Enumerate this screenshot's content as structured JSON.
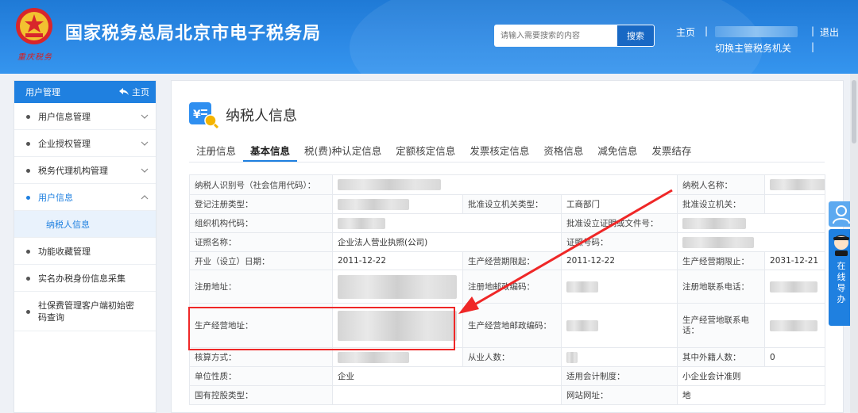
{
  "header": {
    "emblem_caption": "重庆税务",
    "site_title": "国家税务总局北京市电子税务局",
    "search_placeholder": "请输入需要搜索的内容",
    "search_button": "搜索",
    "home_link": "主页",
    "switch_link": "切换主管税务机关",
    "logout_link": "退出",
    "separator": "|"
  },
  "sidebar": {
    "header_title": "用户管理",
    "home_label": "主页",
    "items": [
      {
        "label": "用户信息管理"
      },
      {
        "label": "企业授权管理"
      },
      {
        "label": "税务代理机构管理"
      },
      {
        "label": "用户信息"
      },
      {
        "label": "纳税人信息"
      },
      {
        "label": "功能收藏管理"
      },
      {
        "label": "实名办税身份信息采集"
      },
      {
        "label": "社保费管理客户端初始密码查询"
      }
    ]
  },
  "main": {
    "page_title": "纳税人信息",
    "tabs": [
      {
        "label": "注册信息"
      },
      {
        "label": "基本信息"
      },
      {
        "label": "税(费)种认定信息"
      },
      {
        "label": "定额核定信息"
      },
      {
        "label": "发票核定信息"
      },
      {
        "label": "资格信息"
      },
      {
        "label": "减免信息"
      },
      {
        "label": "发票结存"
      }
    ],
    "fields": {
      "taxpayer_id_label": "纳税人识别号（社会信用代码）：",
      "taxpayer_name_label": "纳税人名称：",
      "reg_type_label": "登记注册类型：",
      "approve_type_label": "批准设立机关类型：",
      "approve_type_value": "工商部门",
      "approve_org_label": "批准设立机关：",
      "org_code_label": "组织机构代码：",
      "approve_doc_label": "批准设立证明或文件号：",
      "cert_name_label": "证照名称：",
      "cert_name_value": "企业法人营业执照(公司)",
      "cert_no_label": "证照号码：",
      "open_date_label": "开业（设立）日期：",
      "open_date_value": "2011-12-22",
      "period_start_label": "生产经营期限起：",
      "period_start_value": "2011-12-22",
      "period_end_label": "生产经营期限止：",
      "period_end_value": "2031-12-21",
      "reg_addr_label": "注册地址：",
      "reg_post_label": "注册地邮政编码：",
      "reg_phone_label": "注册地联系电话：",
      "biz_addr_label": "生产经营地址：",
      "biz_post_label": "生产经营地邮政编码：",
      "biz_phone_label": "生产经营地联系电话：",
      "acct_method_label": "核算方式：",
      "employees_label": "从业人数：",
      "foreign_label": "其中外籍人数：",
      "foreign_value": "0",
      "unit_nature_label": "单位性质：",
      "unit_nature_value": "企业",
      "acct_system_label": "适用会计制度：",
      "acct_system_value": "小企业会计准则",
      "state_holding_label": "国有控股类型：",
      "website_label": "网站网址：",
      "website_value": "地"
    }
  },
  "float": {
    "guide_chars": [
      "在",
      "线",
      "导",
      "办"
    ]
  },
  "colors": {
    "header_blue": "#2d8ae6",
    "accent": "#1f80e0",
    "highlight_red": "#ef2727"
  }
}
